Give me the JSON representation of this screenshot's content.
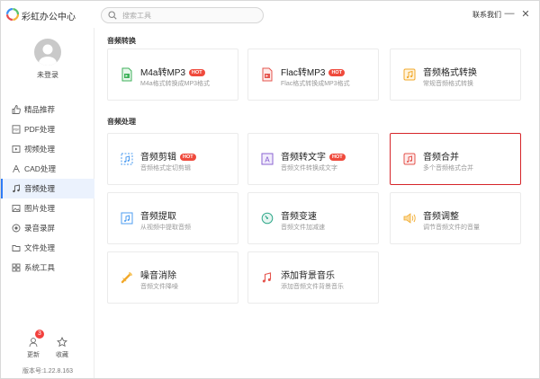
{
  "app": {
    "title": "彩虹办公中心"
  },
  "search": {
    "placeholder": "搜索工具"
  },
  "header": {
    "contact": "联系我们",
    "minimize": "—",
    "close": "✕"
  },
  "user": {
    "login_label": "未登录"
  },
  "sidebar": {
    "items": [
      {
        "label": "精品推荐",
        "icon": "thumbs-up-icon"
      },
      {
        "label": "PDF处理",
        "icon": "pdf-icon"
      },
      {
        "label": "视频处理",
        "icon": "video-icon"
      },
      {
        "label": "CAD处理",
        "icon": "cad-icon"
      },
      {
        "label": "音频处理",
        "icon": "music-icon",
        "active": true
      },
      {
        "label": "图片处理",
        "icon": "image-icon"
      },
      {
        "label": "录音录屏",
        "icon": "record-icon"
      },
      {
        "label": "文件处理",
        "icon": "folder-icon"
      },
      {
        "label": "系统工具",
        "icon": "tools-icon"
      }
    ],
    "update_label": "更新",
    "update_badge": "3",
    "favorite_label": "收藏",
    "version": "版本号:1.22.8.163"
  },
  "sections": {
    "convert": {
      "title": "音频转换",
      "cards": [
        {
          "title": "M4a转MP3",
          "desc": "M4a格式转换成MP3格式",
          "hot": "HOT"
        },
        {
          "title": "Flac转MP3",
          "desc": "Flac格式转换成MP3格式",
          "hot": "HOT"
        },
        {
          "title": "音频格式转换",
          "desc": "常规音频格式转换"
        }
      ]
    },
    "process": {
      "title": "音频处理",
      "cards": [
        {
          "title": "音频剪辑",
          "desc": "音频格式定切剪辑",
          "hot": "HOT"
        },
        {
          "title": "音频转文字",
          "desc": "音频文件转换成文字",
          "hot": "HOT"
        },
        {
          "title": "音频合并",
          "desc": "多个音频格式合并"
        },
        {
          "title": "音频提取",
          "desc": "从视频中提取音频"
        },
        {
          "title": "音频变速",
          "desc": "音频文件加减速"
        },
        {
          "title": "音频调整",
          "desc": "调节音频文件的音量"
        },
        {
          "title": "噪音消除",
          "desc": "音频文件降噪"
        },
        {
          "title": "添加背景音乐",
          "desc": "添加音频文件背景音乐"
        }
      ]
    }
  },
  "colors": {
    "accent": "#2f7cf6",
    "hot": "#ef4a3c",
    "highlight": "#d6252a",
    "active_bg": "#ebf2fd"
  }
}
